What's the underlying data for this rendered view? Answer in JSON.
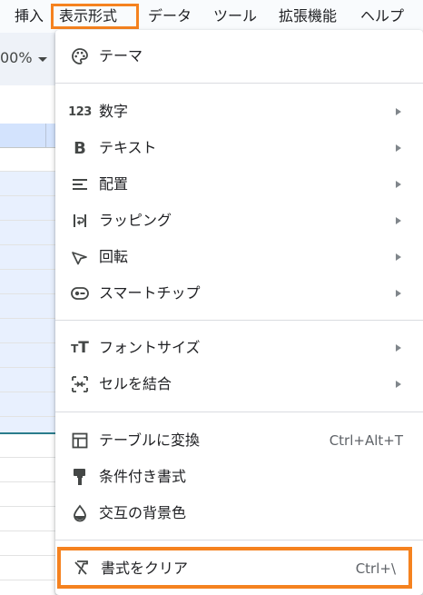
{
  "menubar": {
    "items": [
      "挿入",
      "表示形式",
      "データ",
      "ツール",
      "拡張機能",
      "ヘルプ"
    ]
  },
  "toolbar": {
    "zoom_fragment": "00%"
  },
  "menu": {
    "theme": "テーマ",
    "number": "数字",
    "text": "テキスト",
    "alignment": "配置",
    "wrapping": "ラッピング",
    "rotation": "回転",
    "smart_chips": "スマートチップ",
    "font_size": "フォントサイズ",
    "merge_cells": "セルを結合",
    "convert_table": "テーブルに変換",
    "convert_table_shortcut": "Ctrl+Alt+T",
    "conditional_formatting": "条件付き書式",
    "alternating_colors": "交互の背景色",
    "clear_formatting": "書式をクリア",
    "clear_formatting_shortcut": "Ctrl+\\"
  },
  "colors": {
    "highlight": "#f5821f",
    "selection": "#e8f0fe"
  },
  "icons": [
    "palette-icon",
    "number-123-icon",
    "bold-icon",
    "align-left-icon",
    "wrap-icon",
    "rotate-icon",
    "smart-chip-icon",
    "font-size-icon",
    "merge-cells-icon",
    "table-icon",
    "paint-roller-icon",
    "droplet-icon",
    "clear-format-icon"
  ]
}
